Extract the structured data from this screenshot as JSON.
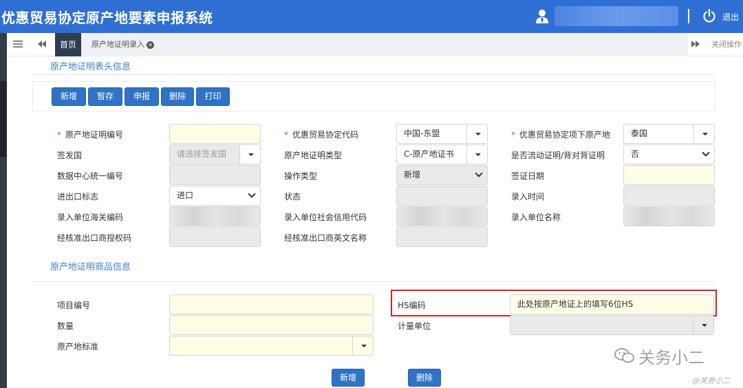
{
  "header": {
    "app_title": "优惠贸易协定原产地要素申报系统",
    "logout_label": "退出",
    "accent_color": "#2f6fd4"
  },
  "tabs": {
    "home_label": "首页",
    "cert_tab_label": "原产地证明录入",
    "close_ops_label": "关闭操作"
  },
  "cert_header": {
    "section_title": "原产地证明表头信息",
    "buttons": {
      "add": "新增",
      "save_draft": "暂存",
      "declare": "申报",
      "delete": "删除",
      "print": "打印"
    },
    "labels": {
      "cert_no": "原产地证明编号",
      "agreement_code": "优惠贸易协定代码",
      "origin_under_agreement": "优惠贸易协定项下原产地",
      "issuing_country": "签发国",
      "cert_type": "原产地证明类型",
      "is_movement_cert": "是否流动证明/背对背证明",
      "data_center_id": "数据中心统一编号",
      "operation_type": "操作类型",
      "issue_date": "签证日期",
      "ie_flag": "进出口标志",
      "status": "状态",
      "entry_time": "录入时间",
      "entry_unit_customs_code": "录入单位海关编码",
      "entry_unit_credit_code": "录入单位社会信用代码",
      "entry_unit_name": "录入单位名称",
      "approved_exporter_auth_code": "经核准出口商授权码",
      "approved_exporter_en_name": "经核准出口商英文名称"
    },
    "values": {
      "cert_no": "",
      "agreement_code": "中国-东盟",
      "origin_under_agreement": "泰国",
      "issuing_country_placeholder": "请选择签发国",
      "cert_type": "C-原产地证书",
      "is_movement_cert": "否",
      "data_center_id": "",
      "operation_type": "新增",
      "issue_date": "",
      "ie_flag": "进口",
      "status": "",
      "entry_time": "",
      "approved_exporter_auth_code": "",
      "approved_exporter_en_name": ""
    }
  },
  "goods": {
    "section_title": "原产地证明商品信息",
    "labels": {
      "item_no": "项目编号",
      "hs_code": "HS编码",
      "quantity": "数量",
      "unit": "计量单位",
      "origin_criterion": "原产地标准"
    },
    "values": {
      "item_no": "",
      "hs_code": "此处按原产地证上的填写6位HS",
      "quantity": "",
      "unit": "",
      "origin_criterion": ""
    },
    "buttons": {
      "add": "新增",
      "delete": "删除"
    }
  },
  "watermark": {
    "text": "关务小二",
    "small_text": "@关务小二"
  }
}
